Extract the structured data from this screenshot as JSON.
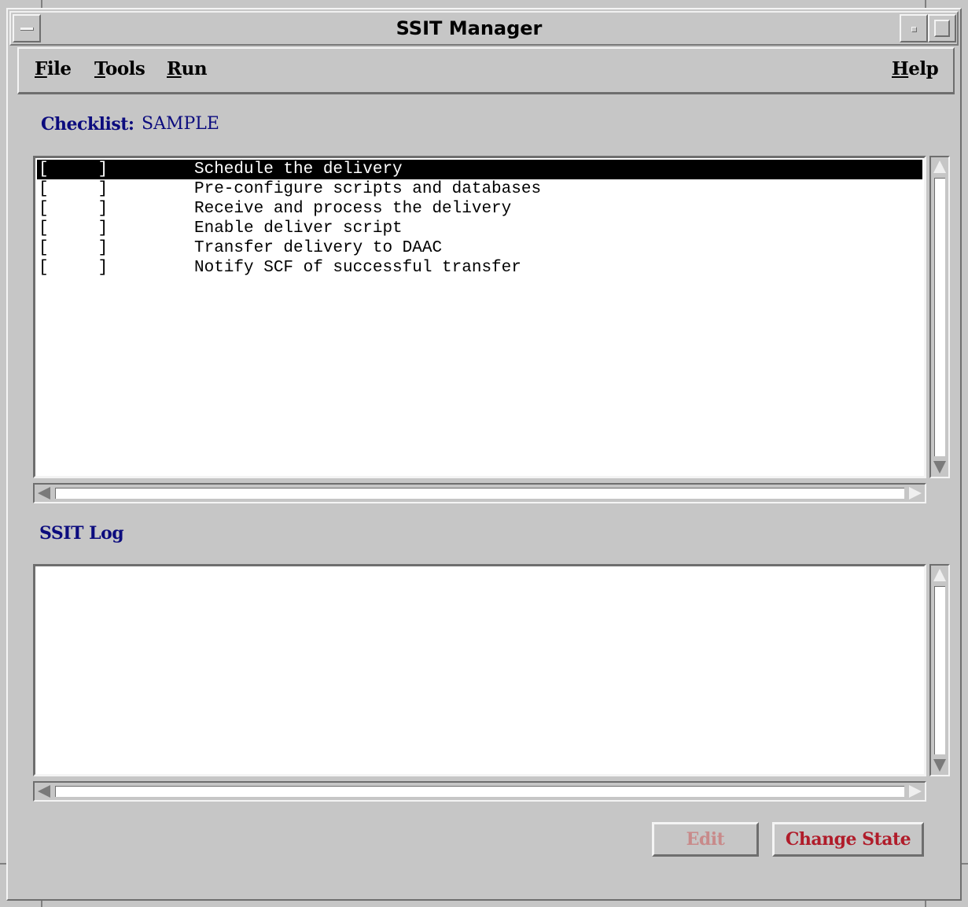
{
  "window": {
    "title": "SSIT Manager"
  },
  "menubar": {
    "items": [
      {
        "label": "File",
        "mnemonic": "F"
      },
      {
        "label": "Tools",
        "mnemonic": "T"
      },
      {
        "label": "Run",
        "mnemonic": "R"
      }
    ],
    "help": {
      "label": "Help",
      "mnemonic": "H"
    }
  },
  "checklist": {
    "label": "Checklist:",
    "name": "SAMPLE",
    "rows": [
      {
        "status": "[     ]",
        "task": "Schedule the delivery",
        "selected": true
      },
      {
        "status": "[     ]",
        "task": "Pre-configure scripts and databases",
        "selected": false
      },
      {
        "status": "[     ]",
        "task": "Receive and process the delivery",
        "selected": false
      },
      {
        "status": "[     ]",
        "task": "Enable deliver script",
        "selected": false
      },
      {
        "status": "[     ]",
        "task": "Transfer delivery to DAAC",
        "selected": false
      },
      {
        "status": "[     ]",
        "task": "Notify SCF of successful transfer",
        "selected": false
      }
    ]
  },
  "log": {
    "label": "SSIT Log",
    "content": ""
  },
  "buttons": {
    "edit": {
      "label": "Edit",
      "enabled": false
    },
    "change_state": {
      "label": "Change State",
      "enabled": true
    }
  },
  "colors": {
    "label_blue": "#0c0c7e",
    "button_red": "#b01c2a",
    "selection": "#000000",
    "chrome": "#c6c6c6"
  }
}
